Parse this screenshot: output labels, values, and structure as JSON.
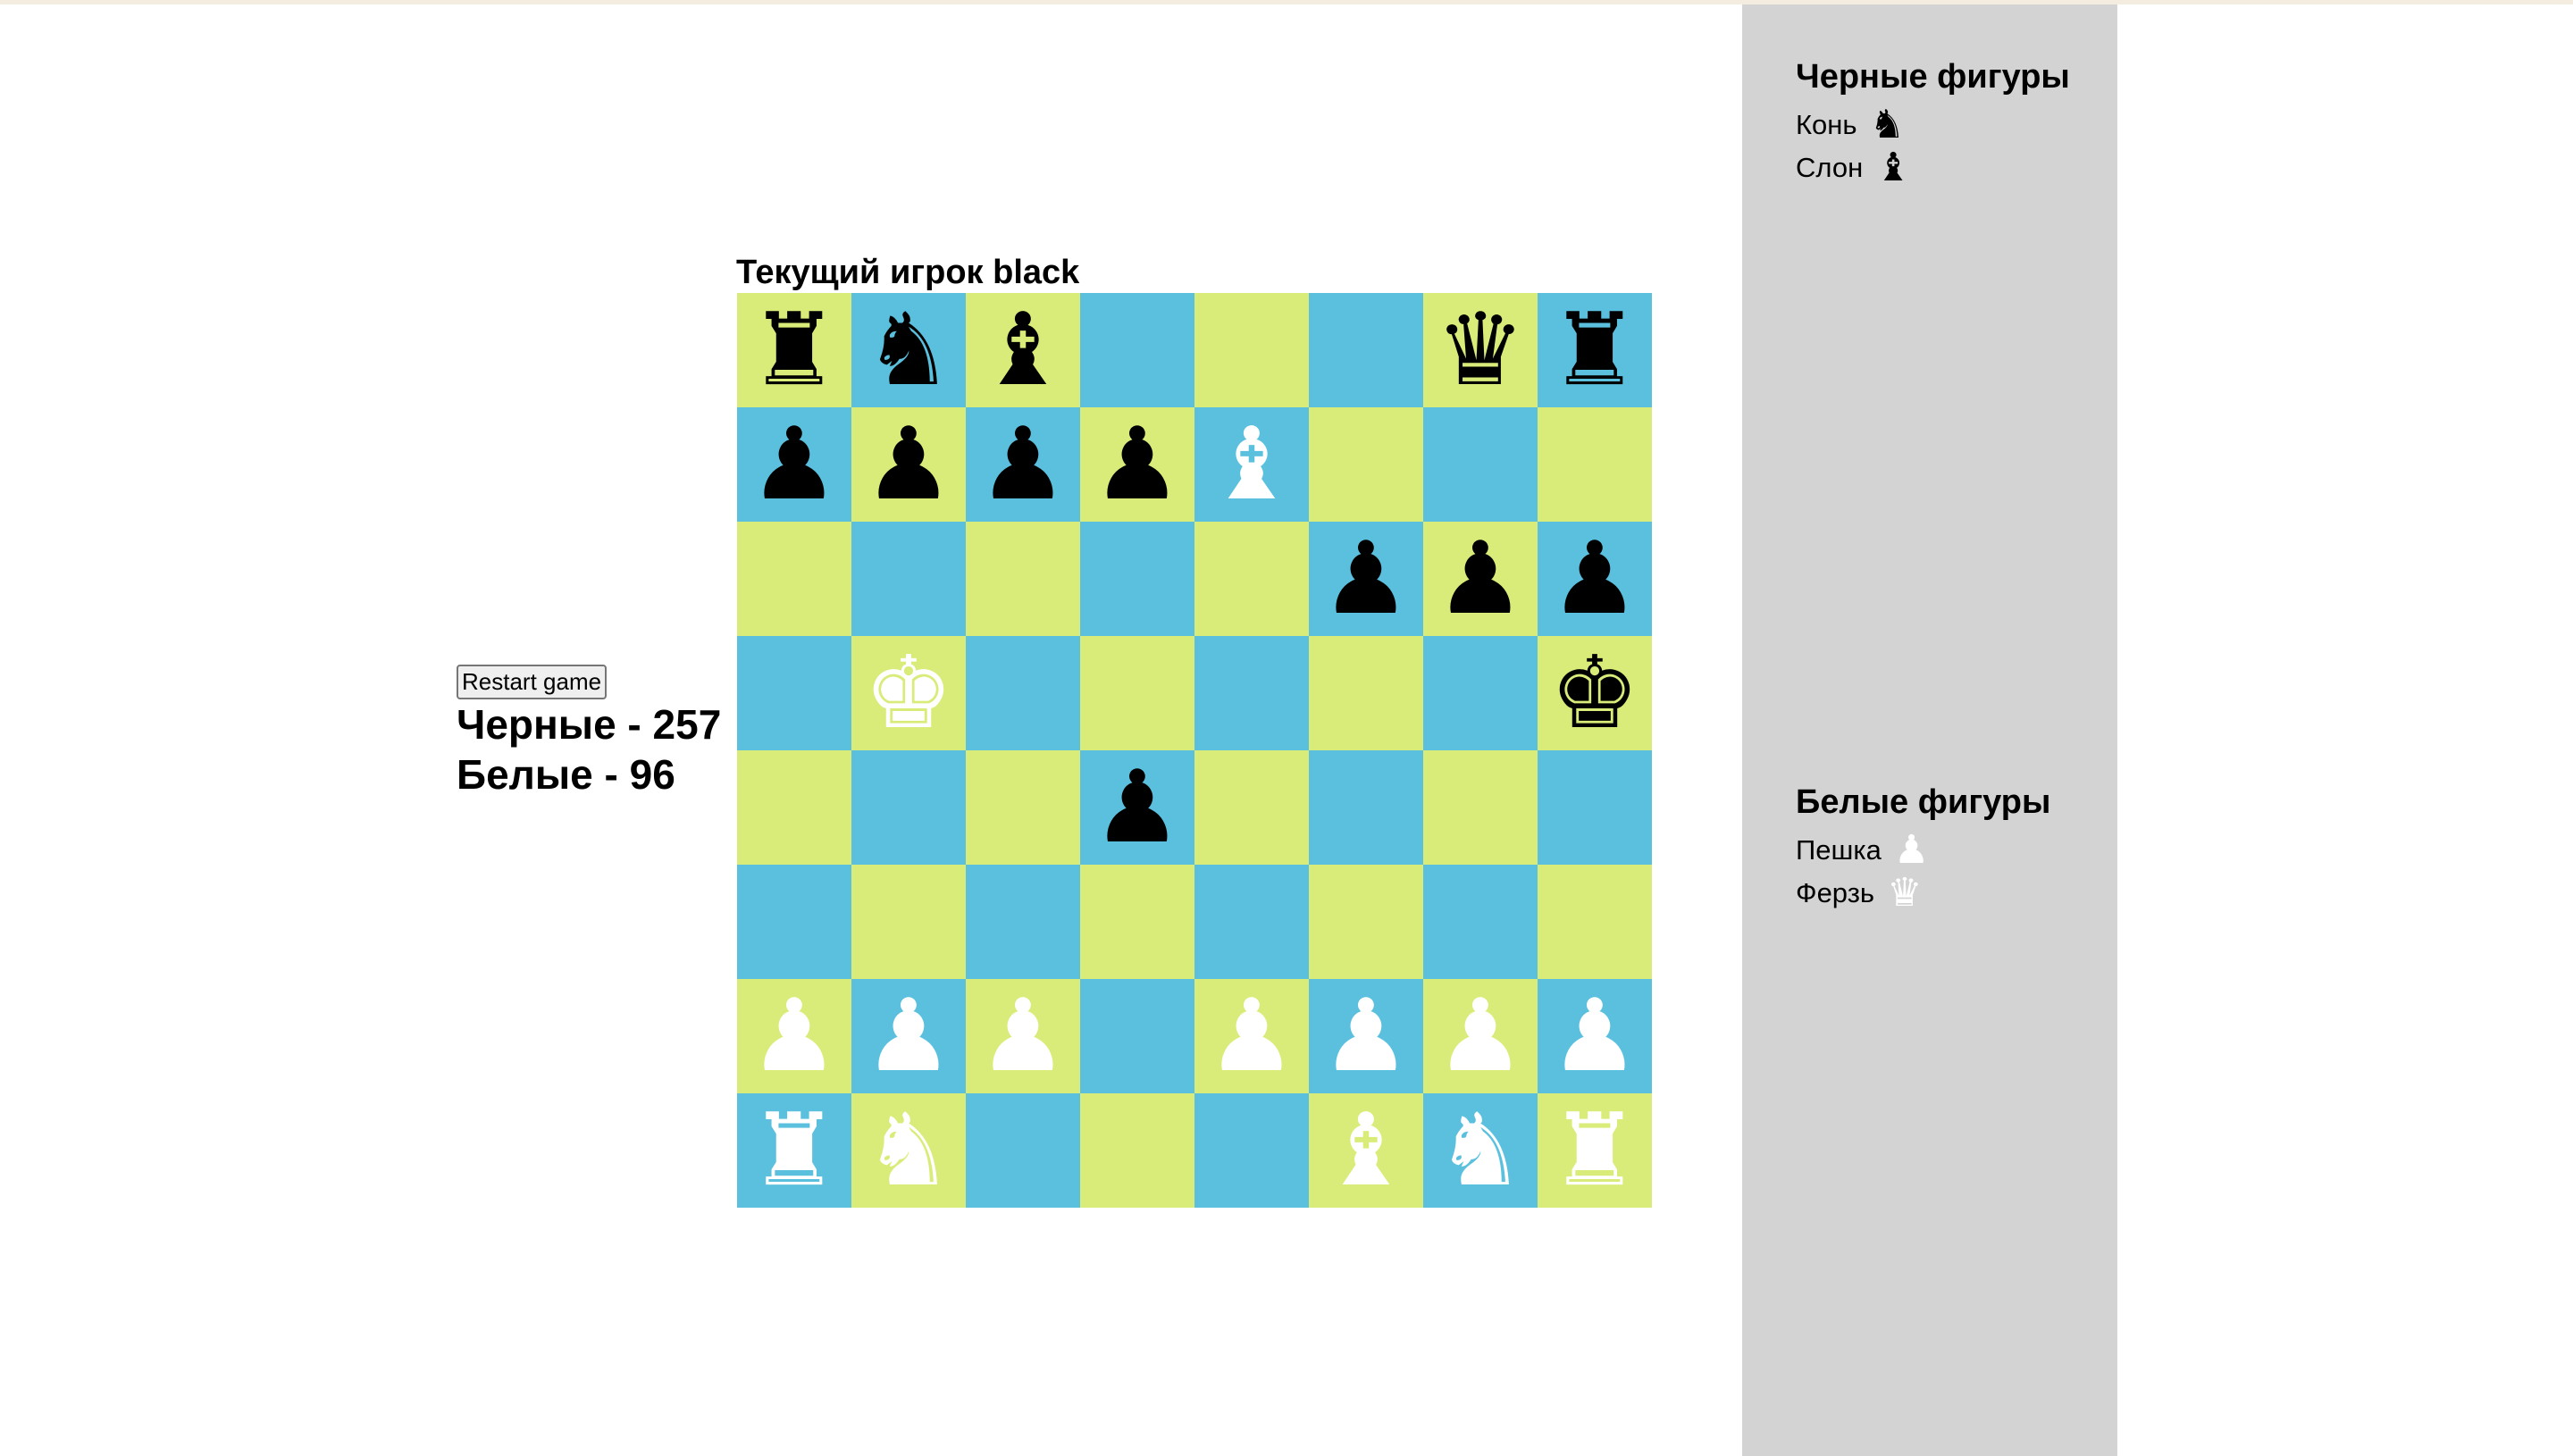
{
  "turn_label": "Текущий игрок black",
  "restart_label": "Restart game",
  "scores": {
    "black": "Черные - 257",
    "white": "Белые - 96"
  },
  "captured": {
    "black_title": "Черные фигуры",
    "black_items": [
      {
        "label": "Конь",
        "glyph": "♞",
        "color": "black"
      },
      {
        "label": "Слон",
        "glyph": "♝",
        "color": "black"
      }
    ],
    "white_title": "Белые фигуры",
    "white_items": [
      {
        "label": "Пешка",
        "glyph": "♟",
        "color": "white"
      },
      {
        "label": "Ферзь",
        "glyph": "♛",
        "color": "white"
      }
    ]
  },
  "colors": {
    "light_square": "#d9ec79",
    "dark_square": "#5bc0de",
    "sidebar": "#d3d3d3"
  },
  "board": [
    [
      "br",
      "bn",
      "bb",
      "",
      "",
      "",
      "bq",
      "br"
    ],
    [
      "bp",
      "bp",
      "bp",
      "bp",
      "wb",
      "",
      "",
      ""
    ],
    [
      "",
      "",
      "",
      "",
      "",
      "bp",
      "bp",
      "bp"
    ],
    [
      "",
      "wk",
      "",
      "",
      "",
      "",
      "",
      "bk"
    ],
    [
      "",
      "",
      "",
      "bp",
      "",
      "",
      "",
      ""
    ],
    [
      "",
      "",
      "",
      "",
      "",
      "",
      "",
      ""
    ],
    [
      "wp",
      "wp",
      "wp",
      "",
      "wp",
      "wp",
      "wp",
      "wp"
    ],
    [
      "wr",
      "wn",
      "",
      "",
      "",
      "wb",
      "wn",
      "wr"
    ]
  ]
}
